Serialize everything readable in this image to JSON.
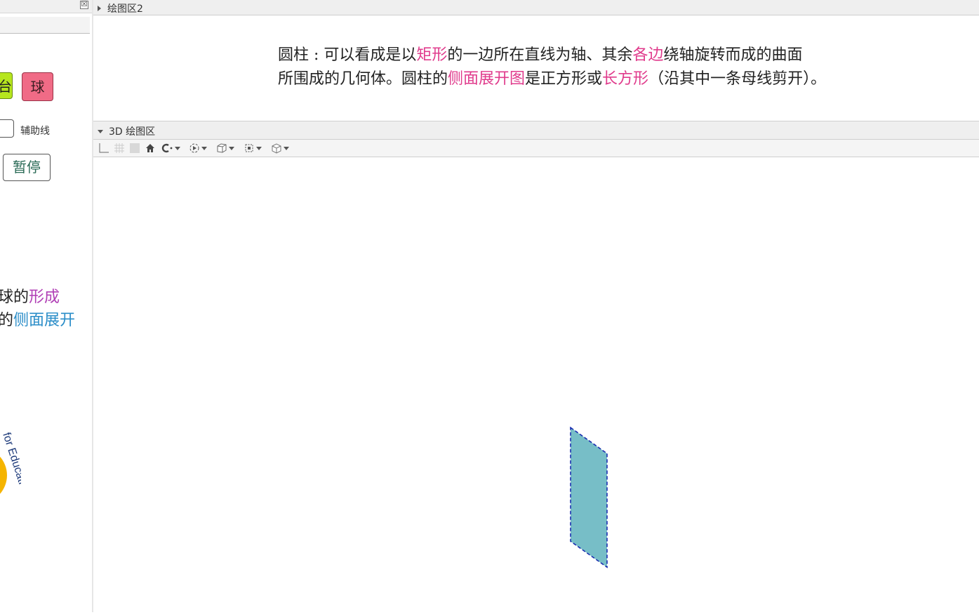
{
  "left_panel": {
    "close_glyph": "☒",
    "btn_partial_char": "台",
    "ball_button": "球",
    "aux_line_label": "辅助线",
    "pause_button": "暂停",
    "text_line1_prefix": "球的",
    "text_line1_highlight": "形成",
    "text_line2_prefix": "的",
    "text_line2_highlight": "侧面展开",
    "logo_text": "for Educati"
  },
  "graphics2": {
    "title": "绘图区2"
  },
  "definition": {
    "line1": [
      {
        "text": "圆柱 : 可以看成是以",
        "hl": false
      },
      {
        "text": "矩形",
        "hl": true
      },
      {
        "text": "的一边所在直线为轴、其余",
        "hl": false
      },
      {
        "text": "各边",
        "hl": true
      },
      {
        "text": "绕轴旋转而成的曲面",
        "hl": false
      }
    ],
    "line2": [
      {
        "text": "所围成的几何体。圆柱的",
        "hl": false
      },
      {
        "text": "侧面展开图",
        "hl": true
      },
      {
        "text": "是正方形或",
        "hl": false
      },
      {
        "text": "长方形",
        "hl": true
      },
      {
        "text": "（沿其中一条母线剪开）。",
        "hl": false
      }
    ]
  },
  "view3d": {
    "title": "3D 绘图区",
    "toolbar_icons": [
      "axes-icon",
      "grid-icon",
      "plane-icon",
      "home-icon",
      "rotate-view-icon",
      "animate-icon",
      "view-cube-icon",
      "projection-icon",
      "standard-view-icon"
    ]
  },
  "colors": {
    "highlight_pink": "#e03b8c",
    "highlight_purple": "#b03fb5",
    "highlight_blue": "#2a8dc8",
    "surface_fill": "#77bec7",
    "surface_edge": "#1a2fb0",
    "ball_button_bg": "#f06b86",
    "green_button_bg": "#b6e61e"
  }
}
